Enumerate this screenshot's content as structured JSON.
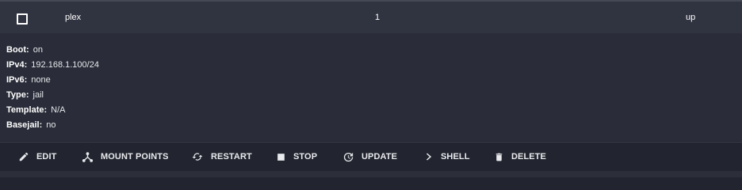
{
  "row": {
    "name": "plex",
    "number": "1",
    "state": "up"
  },
  "details": [
    {
      "key": "Boot:",
      "value": "on"
    },
    {
      "key": "IPv4:",
      "value": "192.168.1.100/24"
    },
    {
      "key": "IPv6:",
      "value": "none"
    },
    {
      "key": "Type:",
      "value": "jail"
    },
    {
      "key": "Template:",
      "value": "N/A"
    },
    {
      "key": "Basejail:",
      "value": "no"
    }
  ],
  "actions": {
    "edit": "EDIT",
    "mount_points": "MOUNT POINTS",
    "restart": "RESTART",
    "stop": "STOP",
    "update": "UPDATE",
    "shell": "SHELL",
    "delete": "DELETE"
  },
  "colors": {
    "row_bg": "#303340",
    "details_bg": "#2a2d39",
    "text": "#ffffff"
  }
}
